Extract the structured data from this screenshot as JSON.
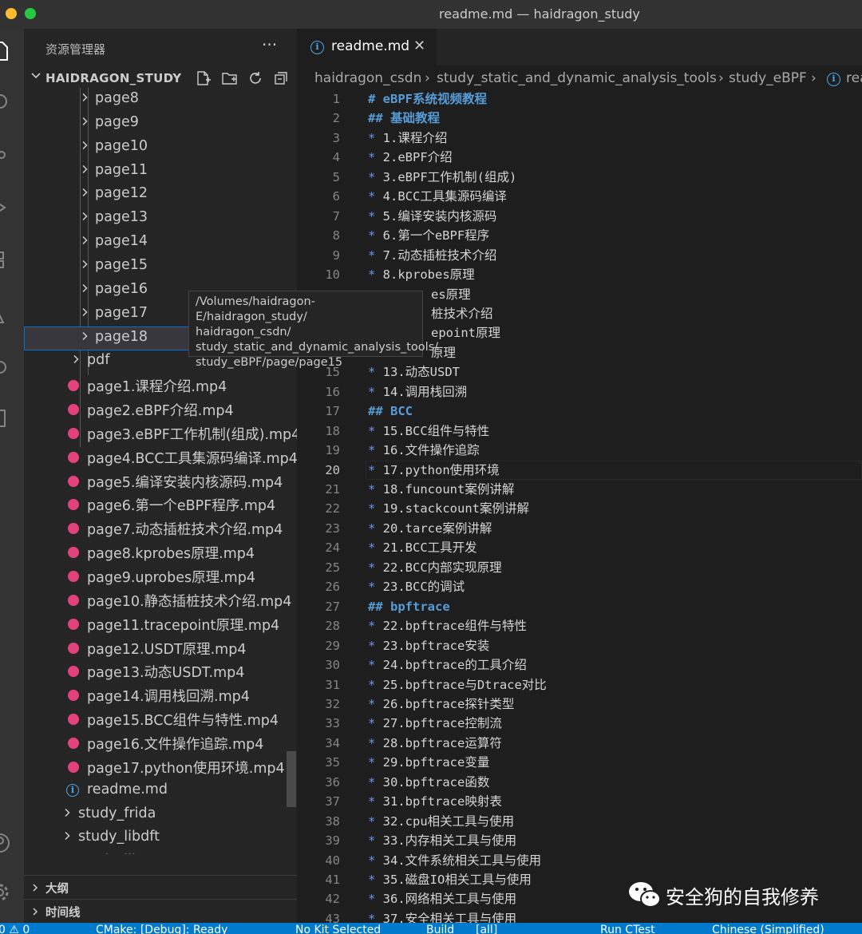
{
  "window": {
    "title": "readme.md — haidragon_study"
  },
  "sidebar": {
    "title": "资源管理器",
    "more_glyph": "···",
    "root_folder": "HAIDRAGON_STUDY",
    "tree": [
      {
        "label": "page8",
        "kind": "folder"
      },
      {
        "label": "page9",
        "kind": "folder"
      },
      {
        "label": "page10",
        "kind": "folder"
      },
      {
        "label": "page11",
        "kind": "folder"
      },
      {
        "label": "page12",
        "kind": "folder"
      },
      {
        "label": "page13",
        "kind": "folder"
      },
      {
        "label": "page14",
        "kind": "folder"
      },
      {
        "label": "page15",
        "kind": "folder"
      },
      {
        "label": "page16",
        "kind": "folder"
      },
      {
        "label": "page17",
        "kind": "folder"
      },
      {
        "label": "page18",
        "kind": "folder",
        "selected": true
      },
      {
        "label": "pdf",
        "kind": "folder"
      },
      {
        "label": "page1.课程介绍.mp4",
        "kind": "mp4"
      },
      {
        "label": "page2.eBPF介绍.mp4",
        "kind": "mp4"
      },
      {
        "label": "page3.eBPF工作机制(组成).mp4",
        "kind": "mp4"
      },
      {
        "label": "page4.BCC工具集源码编译.mp4",
        "kind": "mp4"
      },
      {
        "label": "page5.编译安装内核源码.mp4",
        "kind": "mp4"
      },
      {
        "label": "page6.第一个eBPF程序.mp4",
        "kind": "mp4"
      },
      {
        "label": "page7.动态插桩技术介绍.mp4",
        "kind": "mp4"
      },
      {
        "label": "page8.kprobes原理.mp4",
        "kind": "mp4"
      },
      {
        "label": "page9.uprobes原理.mp4",
        "kind": "mp4"
      },
      {
        "label": "page10.静态插桩技术介绍.mp4",
        "kind": "mp4"
      },
      {
        "label": "page11.tracepoint原理.mp4",
        "kind": "mp4"
      },
      {
        "label": "page12.USDT原理.mp4",
        "kind": "mp4"
      },
      {
        "label": "page13.动态USDT.mp4",
        "kind": "mp4"
      },
      {
        "label": "page14.调用栈回溯.mp4",
        "kind": "mp4"
      },
      {
        "label": "page15.BCC组件与特性.mp4",
        "kind": "mp4"
      },
      {
        "label": "page16.文件操作追踪.mp4",
        "kind": "mp4"
      },
      {
        "label": "page17.python使用环境.mp4",
        "kind": "mp4"
      },
      {
        "label": "readme.md",
        "kind": "info"
      },
      {
        "label": "study_frida",
        "kind": "folder"
      },
      {
        "label": "study_libdft",
        "kind": "folder"
      },
      {
        "label": "study_libFuzzer",
        "kind": "folder"
      }
    ],
    "tooltip_lines": [
      "/Volumes/haidragon-E/haidragon_study/",
      "haidragon_csdn/",
      "study_static_and_dynamic_analysis_tools/",
      "study_eBPF/page/page15"
    ],
    "outline_label": "大纲",
    "timeline_label": "时间线"
  },
  "editor": {
    "tab_label": "readme.md",
    "tab_close": "✕",
    "breadcrumb": [
      "haidragon_csdn",
      "study_static_and_dynamic_analysis_tools",
      "study_eBPF",
      "rea"
    ],
    "breadcrumb_sep": "›",
    "active_line": 20,
    "lines": [
      {
        "n": "1",
        "t": "# eBPF系统视频教程",
        "h": true
      },
      {
        "n": "2",
        "t": "## 基础教程",
        "h": true
      },
      {
        "n": "3",
        "t": "1.课程介绍"
      },
      {
        "n": "4",
        "t": "2.eBPF介绍"
      },
      {
        "n": "5",
        "t": "3.eBPF工作机制(组成)"
      },
      {
        "n": "6",
        "t": "4.BCC工具集源码编译"
      },
      {
        "n": "7",
        "t": "5.编译安装内核源码"
      },
      {
        "n": "8",
        "t": "6.第一个eBPF程序"
      },
      {
        "n": "9",
        "t": "7.动态插桩技术介绍"
      },
      {
        "n": "10",
        "t": "8.kprobes原理"
      },
      {
        "n": "",
        "t": "es原理",
        "partial": true
      },
      {
        "n": "",
        "t": "桩技术介绍",
        "partial": true
      },
      {
        "n": "",
        "t": "epoint原理",
        "partial": true
      },
      {
        "n": "",
        "t": "原理",
        "partial": true
      },
      {
        "n": "15",
        "t": "13.动态USDT"
      },
      {
        "n": "16",
        "t": "14.调用栈回溯"
      },
      {
        "n": "17",
        "t": "## BCC",
        "h": true
      },
      {
        "n": "18",
        "t": "15.BCC组件与特性"
      },
      {
        "n": "19",
        "t": "16.文件操作追踪"
      },
      {
        "n": "20",
        "t": "17.python使用环境"
      },
      {
        "n": "21",
        "t": "18.funcount案例讲解"
      },
      {
        "n": "22",
        "t": "19.stackcount案例讲解"
      },
      {
        "n": "23",
        "t": "20.tarce案例讲解"
      },
      {
        "n": "24",
        "t": "21.BCC工具开发"
      },
      {
        "n": "25",
        "t": "22.BCC内部实现原理"
      },
      {
        "n": "26",
        "t": "23.BCC的调试"
      },
      {
        "n": "27",
        "t": "## bpftrace",
        "h": true
      },
      {
        "n": "28",
        "t": "22.bpftrace组件与特性"
      },
      {
        "n": "29",
        "t": "23.bpftrace安装"
      },
      {
        "n": "30",
        "t": "24.bpftrace的工具介绍"
      },
      {
        "n": "31",
        "t": "25.bpftrace与Dtrace对比"
      },
      {
        "n": "32",
        "t": "26.bpftrace探针类型"
      },
      {
        "n": "33",
        "t": "27.bpftrace控制流"
      },
      {
        "n": "34",
        "t": "28.bpftrace运算符"
      },
      {
        "n": "35",
        "t": "29.bpftrace变量"
      },
      {
        "n": "36",
        "t": "30.bpftrace函数"
      },
      {
        "n": "37",
        "t": "31.bpftrace映射表"
      },
      {
        "n": "38",
        "t": "32.cpu相关工具与使用"
      },
      {
        "n": "39",
        "t": "33.内存相关工具与使用"
      },
      {
        "n": "40",
        "t": "34.文件系统相关工具与使用"
      },
      {
        "n": "41",
        "t": "35.磁盘IO相关工具与使用"
      },
      {
        "n": "42",
        "t": "36.网络相关工具与使用"
      },
      {
        "n": "43",
        "t": "37.安全相关工具与使用"
      }
    ]
  },
  "watermark": {
    "text": "安全狗的自我修养"
  },
  "statusbar": {
    "problems": "0 ⚠ 0",
    "cmake": "CMake: [Debug]: Ready",
    "kit": "No Kit Selected",
    "build": "Build",
    "target": "[all]",
    "ctest": "Run CTest",
    "language": "Chinese (Simplified)"
  },
  "colors": {
    "accent": "#007acc",
    "mp4_icon": "#e2417b",
    "info_icon": "#4fa5e8",
    "heading": "#569cd6"
  }
}
